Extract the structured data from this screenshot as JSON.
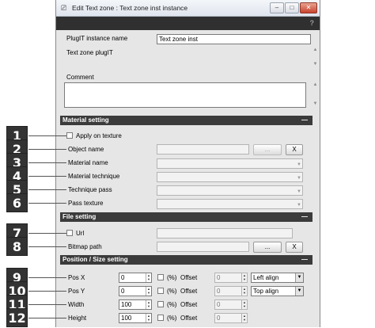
{
  "window": {
    "title": "Edit Text zone : Text zone inst instance",
    "title_icon": "window-icon",
    "minimize": "–",
    "maximize": "□",
    "close": "✕",
    "help": "?"
  },
  "header": {
    "instance_name_label": "PlugIT instance name",
    "instance_name_value": "Text zone inst",
    "plugit_label": "Text zone plugIT",
    "comment_label": "Comment",
    "comment_value": ""
  },
  "sections": {
    "material": {
      "title": "Material setting",
      "toggle": "—",
      "apply_texture_label": "Apply on texture",
      "object_name_label": "Object name",
      "object_browse": "...",
      "object_clear": "X",
      "material_name_label": "Material name",
      "material_technique_label": "Material technique",
      "technique_pass_label": "Technique pass",
      "pass_texture_label": "Pass texture"
    },
    "file": {
      "title": "File setting",
      "toggle": "—",
      "url_label": "Url",
      "bitmap_label": "Bitmap path",
      "bitmap_browse": "...",
      "bitmap_clear": "X"
    },
    "position": {
      "title": "Position / Size setting",
      "toggle": "—",
      "percent_label": "(%)",
      "offset_label": "Offset",
      "rows": [
        {
          "label": "Pos X",
          "value": "0",
          "offset": "0",
          "align": "Left align"
        },
        {
          "label": "Pos Y",
          "value": "0",
          "offset": "0",
          "align": "Top align"
        },
        {
          "label": "Width",
          "value": "100",
          "offset": "0"
        },
        {
          "label": "Height",
          "value": "100",
          "offset": "0"
        }
      ]
    }
  },
  "callouts": [
    "1",
    "2",
    "3",
    "4",
    "5",
    "6",
    "7",
    "8",
    "9",
    "10",
    "11",
    "12"
  ],
  "colors": {
    "section_header": "#3b3b3b",
    "badge": "#333333",
    "window_bg": "#e6e6e6",
    "close_button": "#c8432e"
  }
}
